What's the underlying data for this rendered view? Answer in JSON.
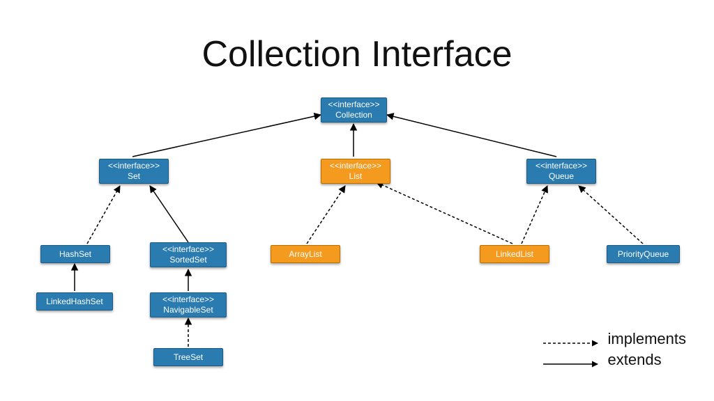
{
  "title": "Collection Interface",
  "stereotype": "<<interface>>",
  "nodes": {
    "collection": {
      "name": "Collection"
    },
    "set": {
      "name": "Set"
    },
    "list": {
      "name": "List"
    },
    "queue": {
      "name": "Queue"
    },
    "hashset": {
      "name": "HashSet"
    },
    "sortedset": {
      "name": "SortedSet"
    },
    "arraylist": {
      "name": "ArrayList"
    },
    "linkedlist": {
      "name": "LinkedList"
    },
    "priorityqueue": {
      "name": "PriorityQueue"
    },
    "linkedhashset": {
      "name": "LinkedHashSet"
    },
    "navigableset": {
      "name": "NavigableSet"
    },
    "treeset": {
      "name": "TreeSet"
    }
  },
  "legend": {
    "implements": "implements",
    "extends": "extends"
  },
  "edges": [
    {
      "from": "set",
      "to": "collection",
      "type": "extends"
    },
    {
      "from": "list",
      "to": "collection",
      "type": "extends"
    },
    {
      "from": "queue",
      "to": "collection",
      "type": "extends"
    },
    {
      "from": "hashset",
      "to": "set",
      "type": "implements"
    },
    {
      "from": "sortedset",
      "to": "set",
      "type": "extends"
    },
    {
      "from": "arraylist",
      "to": "list",
      "type": "implements"
    },
    {
      "from": "linkedlist",
      "to": "list",
      "type": "implements"
    },
    {
      "from": "linkedlist",
      "to": "queue",
      "type": "implements"
    },
    {
      "from": "priorityqueue",
      "to": "queue",
      "type": "implements"
    },
    {
      "from": "linkedhashset",
      "to": "hashset",
      "type": "extends"
    },
    {
      "from": "navigableset",
      "to": "sortedset",
      "type": "extends"
    },
    {
      "from": "treeset",
      "to": "navigableset",
      "type": "implements"
    }
  ]
}
